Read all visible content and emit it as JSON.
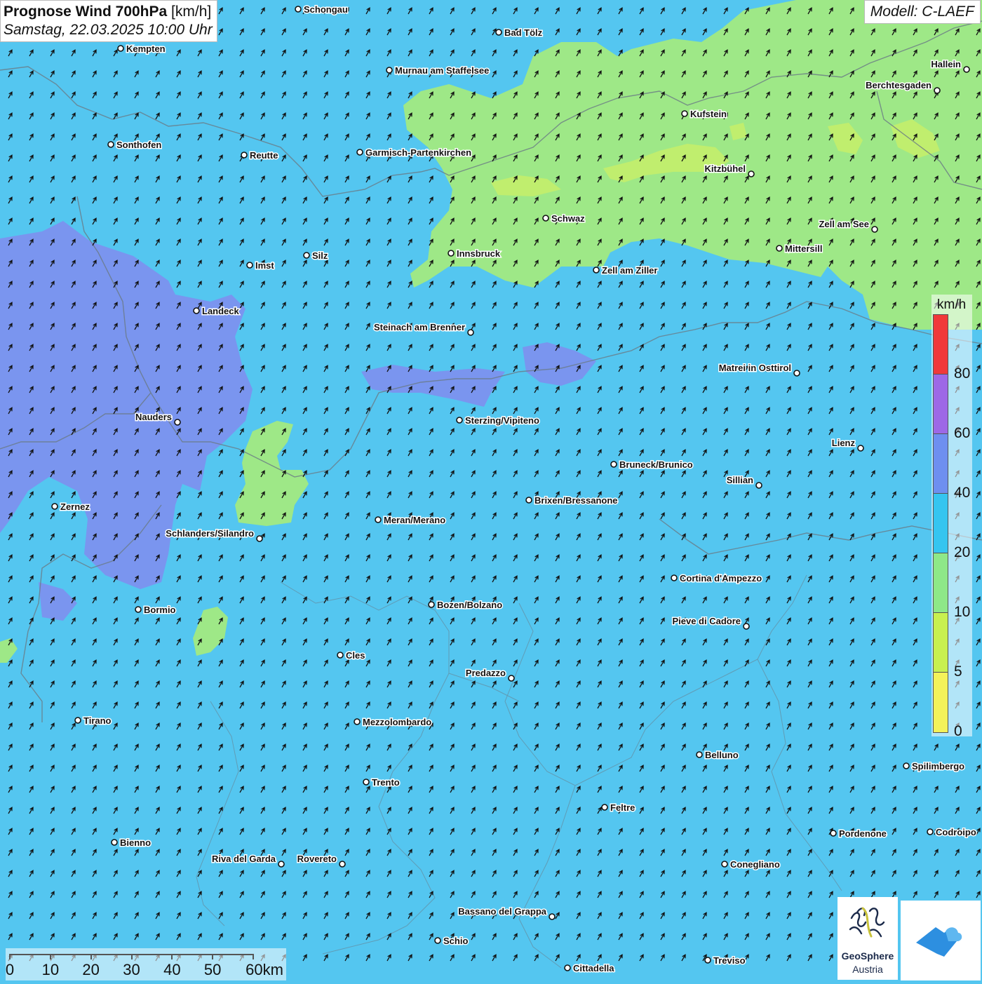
{
  "title": {
    "main": "Prognose Wind 700hPa",
    "unit": "[km/h]",
    "datetime": "Samstag, 22.03.2025 10:00 Uhr"
  },
  "model": "Modell: C-LAEF",
  "legend": {
    "unit": "km/h",
    "labels": [
      "80",
      "60",
      "40",
      "20",
      "10",
      "5",
      "0"
    ],
    "colors": [
      "#f0393a",
      "#9d68e6",
      "#6e8ff0",
      "#35c5f0",
      "#8ee888",
      "#c8f050",
      "#f4f25a"
    ]
  },
  "scalebar": {
    "labels": [
      "0",
      "10",
      "20",
      "30",
      "40",
      "50",
      "60km"
    ]
  },
  "logos": {
    "geosphere_name": "GeoSphere",
    "geosphere_sub": "Austria"
  },
  "map": {
    "colors": {
      "base": "#54c6f0",
      "green": "#9ee887",
      "light_green": "#c6ee6a",
      "purple": "#7e8fee",
      "borders": "#6a7a86"
    },
    "wind_arrow_direction": "north-east",
    "places": [
      {
        "name": "Schongau"
      },
      {
        "name": "Bad Tölz"
      },
      {
        "name": "Kempten"
      },
      {
        "name": "Murnau am Staffelsee"
      },
      {
        "name": "Hallein"
      },
      {
        "name": "Berchtesgaden"
      },
      {
        "name": "Kufstein"
      },
      {
        "name": "Sonthofen"
      },
      {
        "name": "Reutte"
      },
      {
        "name": "Garmisch-Partenkirchen"
      },
      {
        "name": "Kitzbühel"
      },
      {
        "name": "Schwaz"
      },
      {
        "name": "Zell am See"
      },
      {
        "name": "Innsbruck"
      },
      {
        "name": "Mittersill"
      },
      {
        "name": "Imst"
      },
      {
        "name": "Silz"
      },
      {
        "name": "Zell am Ziller"
      },
      {
        "name": "Landeck"
      },
      {
        "name": "Steinach am Brenner"
      },
      {
        "name": "Matrei in Osttirol"
      },
      {
        "name": "Nauders"
      },
      {
        "name": "Sterzing/Vipiteno"
      },
      {
        "name": "Lienz"
      },
      {
        "name": "Bruneck/Brunico"
      },
      {
        "name": "Sillian"
      },
      {
        "name": "Brixen/Bressanone"
      },
      {
        "name": "Zernez"
      },
      {
        "name": "Meran/Merano"
      },
      {
        "name": "Schlanders/Silandro"
      },
      {
        "name": "Cortina d'Ampezzo"
      },
      {
        "name": "Bozen/Bolzano"
      },
      {
        "name": "Bormio"
      },
      {
        "name": "Pieve di Cadore"
      },
      {
        "name": "Cles"
      },
      {
        "name": "Predazzo"
      },
      {
        "name": "Tirano"
      },
      {
        "name": "Mezzolombardo"
      },
      {
        "name": "Belluno"
      },
      {
        "name": "Spilimbergo"
      },
      {
        "name": "Trento"
      },
      {
        "name": "Feltre"
      },
      {
        "name": "Pordenone"
      },
      {
        "name": "Codroipo"
      },
      {
        "name": "Bienno"
      },
      {
        "name": "Riva del Garda"
      },
      {
        "name": "Rovereto"
      },
      {
        "name": "Conegliano"
      },
      {
        "name": "Bassano del Grappa"
      },
      {
        "name": "Schio"
      },
      {
        "name": "Treviso"
      },
      {
        "name": "Cittadella"
      }
    ]
  }
}
